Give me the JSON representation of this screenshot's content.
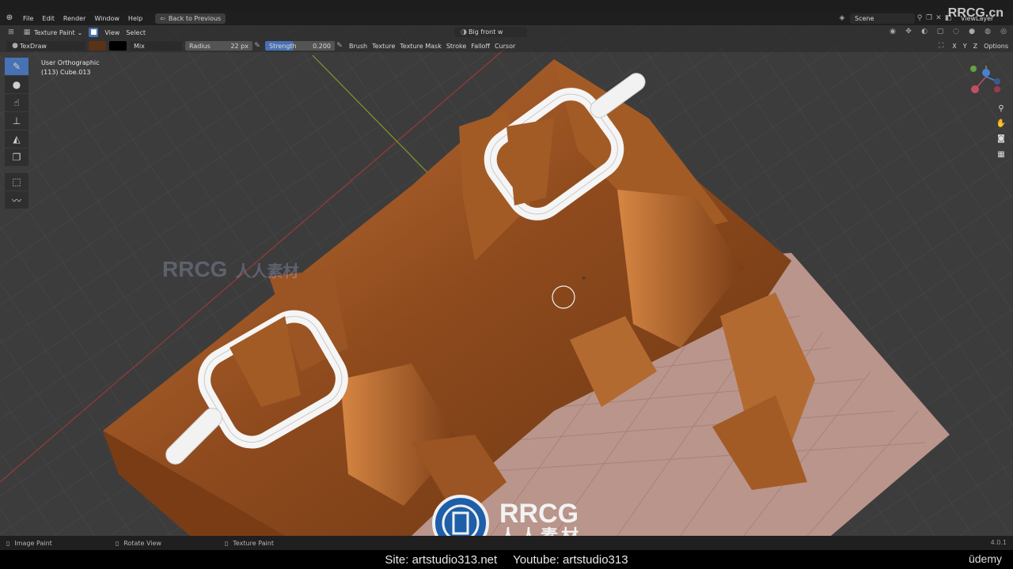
{
  "menubar": {
    "items": [
      "File",
      "Edit",
      "Render",
      "Window",
      "Help"
    ],
    "back_button": "Back to Previous",
    "scene": "Scene",
    "view_layer": "ViewLayer"
  },
  "header1": {
    "mode": "Texture Paint",
    "view": "View",
    "select": "Select",
    "brush_name": "Big front w"
  },
  "header2": {
    "brush": "TexDraw",
    "color_primary": "#5a3217",
    "color_secondary": "#000000",
    "blend": "Mix",
    "radius_label": "Radius",
    "radius_value": "22 px",
    "strength_label": "Strength",
    "strength_value": "0.200",
    "dropdowns": [
      "Brush",
      "Texture",
      "Texture Mask",
      "Stroke",
      "Falloff",
      "Cursor"
    ],
    "axes": [
      "X",
      "Y",
      "Z"
    ],
    "options": "Options"
  },
  "toolbar": {
    "tools": [
      "draw-brush",
      "soften-brush",
      "smear-brush",
      "clone-brush",
      "fill-brush",
      "mask-brush",
      "select-box",
      "annotate"
    ],
    "active": "draw-brush"
  },
  "viewport": {
    "view_name": "User Orthographic",
    "object_info": "(113) Cube.013"
  },
  "statusbar": {
    "left": "Image Paint",
    "middle": "Rotate View",
    "right": "Texture Paint",
    "version": "4.0.1"
  },
  "caption": {
    "site": "Site: artstudio313.net",
    "youtube": "Youtube: artstudio313"
  },
  "watermark": {
    "top": "RRCG.cn",
    "brand": "RRCG",
    "brand_cn": "人人素材",
    "udemy": "ūdemy"
  }
}
